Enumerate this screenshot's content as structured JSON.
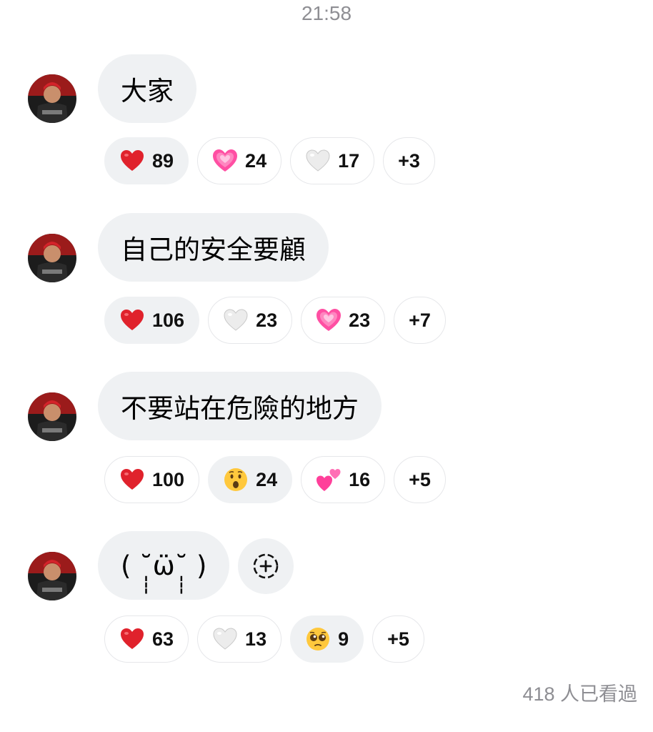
{
  "header": {
    "time": "21:58"
  },
  "messages": [
    {
      "text": "大家",
      "reactions": [
        {
          "icon": "red-heart-icon",
          "count": "89",
          "active": true
        },
        {
          "icon": "growing-heart-icon",
          "count": "24",
          "active": false
        },
        {
          "icon": "white-heart-icon",
          "count": "17",
          "active": false
        }
      ],
      "more": "+3"
    },
    {
      "text": "自己的安全要顧",
      "reactions": [
        {
          "icon": "red-heart-icon",
          "count": "106",
          "active": true
        },
        {
          "icon": "white-heart-icon",
          "count": "23",
          "active": false
        },
        {
          "icon": "growing-heart-icon",
          "count": "23",
          "active": false
        }
      ],
      "more": "+7"
    },
    {
      "text": "不要站在危險的地方",
      "reactions": [
        {
          "icon": "red-heart-icon",
          "count": "100",
          "active": false
        },
        {
          "icon": "surprised-face-icon",
          "count": "24",
          "active": true
        },
        {
          "icon": "two-hearts-icon",
          "count": "16",
          "active": false
        }
      ],
      "more": "+5"
    },
    {
      "text": "( ˘̩̩̩ω̈˘̩̩̩ )",
      "reactions": [
        {
          "icon": "red-heart-icon",
          "count": "63",
          "active": false
        },
        {
          "icon": "white-heart-icon",
          "count": "13",
          "active": false
        },
        {
          "icon": "pleading-face-icon",
          "count": "9",
          "active": true
        }
      ],
      "more": "+5"
    }
  ],
  "footer": {
    "seen_text": "418 人已看過"
  },
  "colors": {
    "bubble": "#eff1f3",
    "meta_text": "#8e8e93",
    "heart_red": "#e0222c",
    "heart_pink": "#ff4fa3"
  }
}
